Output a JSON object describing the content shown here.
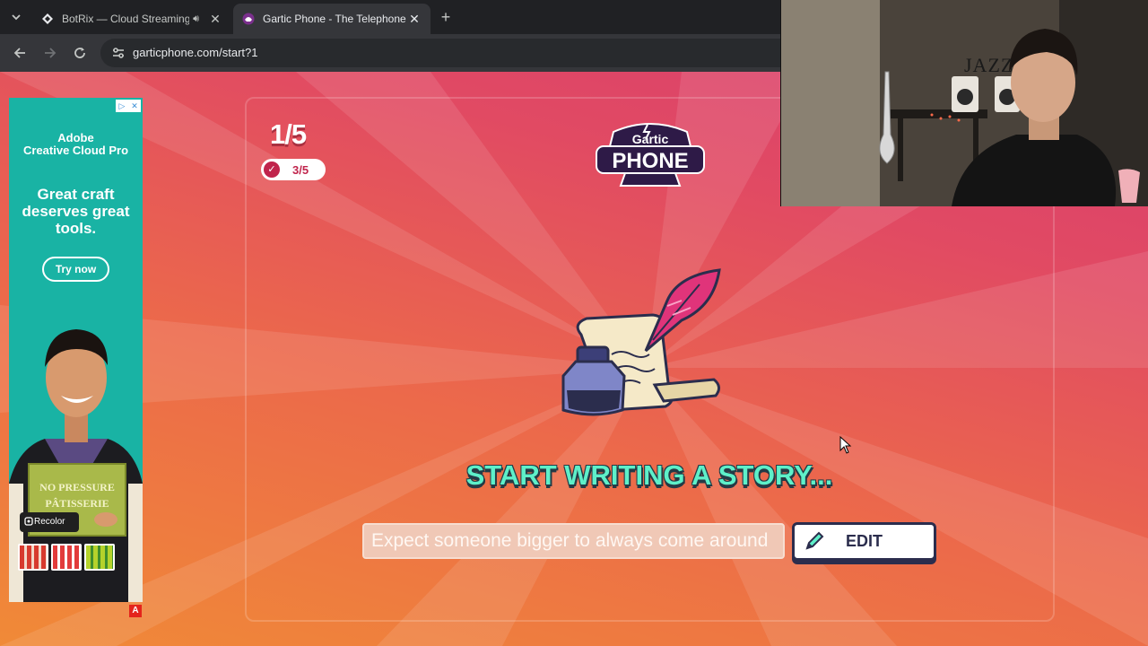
{
  "browser": {
    "tabs": [
      {
        "title": "BotRix — Cloud Streaming Bot",
        "active": false,
        "audio": true
      },
      {
        "title": "Gartic Phone - The Telephone Game",
        "active": true,
        "audio": false
      }
    ],
    "url": "garticphone.com/start?1"
  },
  "ad": {
    "choices_label": "▷",
    "choices_close": "✕",
    "brand_line1": "Adobe",
    "brand_line2": "Creative Cloud Pro",
    "headline": "Great craft deserves great tools.",
    "cta": "Try now",
    "product_text1": "NO PRESSURE",
    "product_text2": "PÂTISSERIE",
    "recolor_label": "Recolor",
    "badge": "A",
    "colors": {
      "background": "#19b3a4"
    }
  },
  "game": {
    "round": "1/5",
    "players_done": "3/5",
    "logo_top": "Gartic",
    "logo_bottom": "PHONE",
    "prompt": "START WRITING A STORY...",
    "input_placeholder": "Expect someone bigger to always come around",
    "edit_label": "EDIT",
    "colors": {
      "prompt": "#5ef0c9",
      "outline": "#2b2d4d",
      "accent": "#c0244c"
    }
  },
  "webcam": {
    "caption": "JAZZ"
  }
}
